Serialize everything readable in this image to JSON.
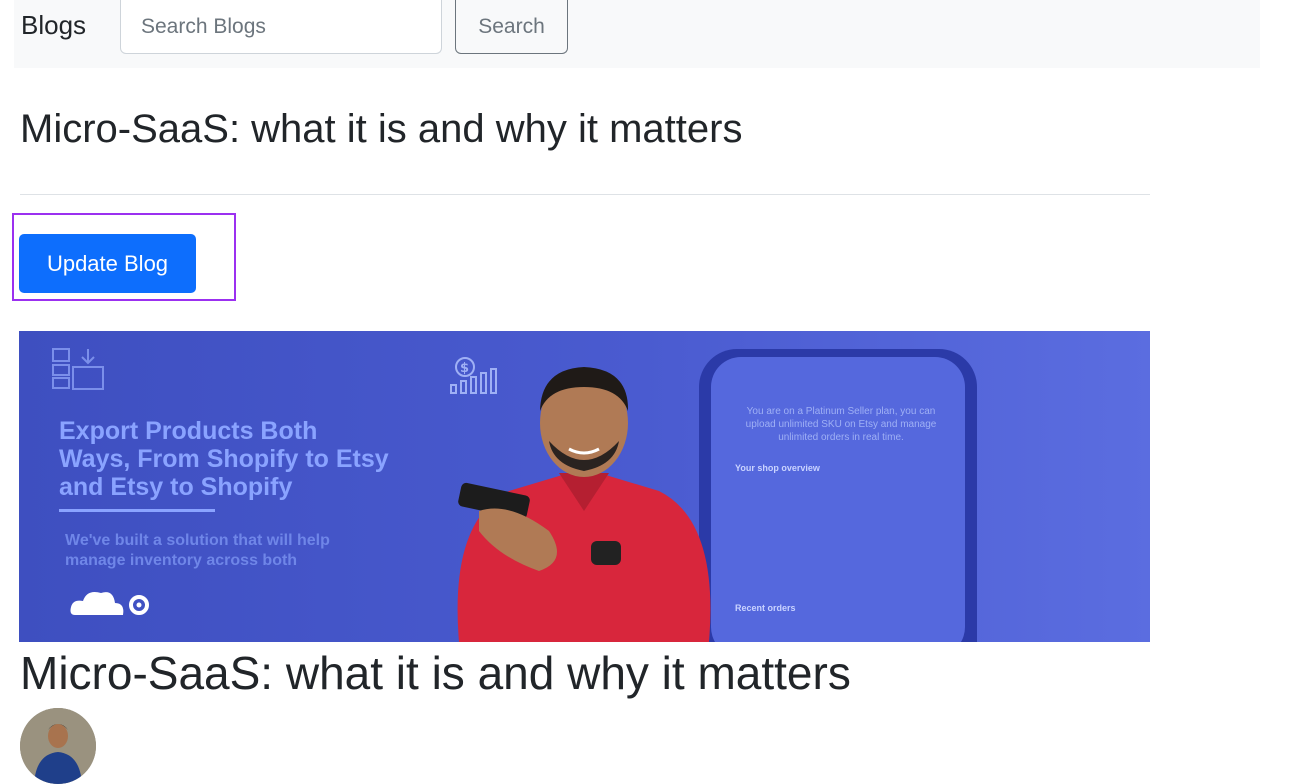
{
  "navbar": {
    "brand": "Blogs",
    "search_placeholder": "Search Blogs",
    "search_button": "Search"
  },
  "page": {
    "title": "Micro-SaaS: what it is and why it matters",
    "update_button": "Update Blog"
  },
  "hero": {
    "headline_1": "Export Products Both",
    "headline_2": "Ways, From Shopify to Etsy",
    "headline_3": "and Etsy to Shopify",
    "subline_1": "We've built a solution that will help",
    "subline_2": "manage inventory across both",
    "phone_text": "You are on a Platinum Seller plan, you can upload unlimited SKU on Etsy and manage unlimited orders in real time.",
    "phone_section_1": "Your shop overview",
    "phone_section_2": "Recent orders"
  },
  "blog": {
    "title": "Micro-SaaS: what it is and why it matters"
  },
  "colors": {
    "primary": "#0d6efd",
    "focus_ring": "#9b30f0",
    "hero_bg": "#4a5bd0"
  }
}
